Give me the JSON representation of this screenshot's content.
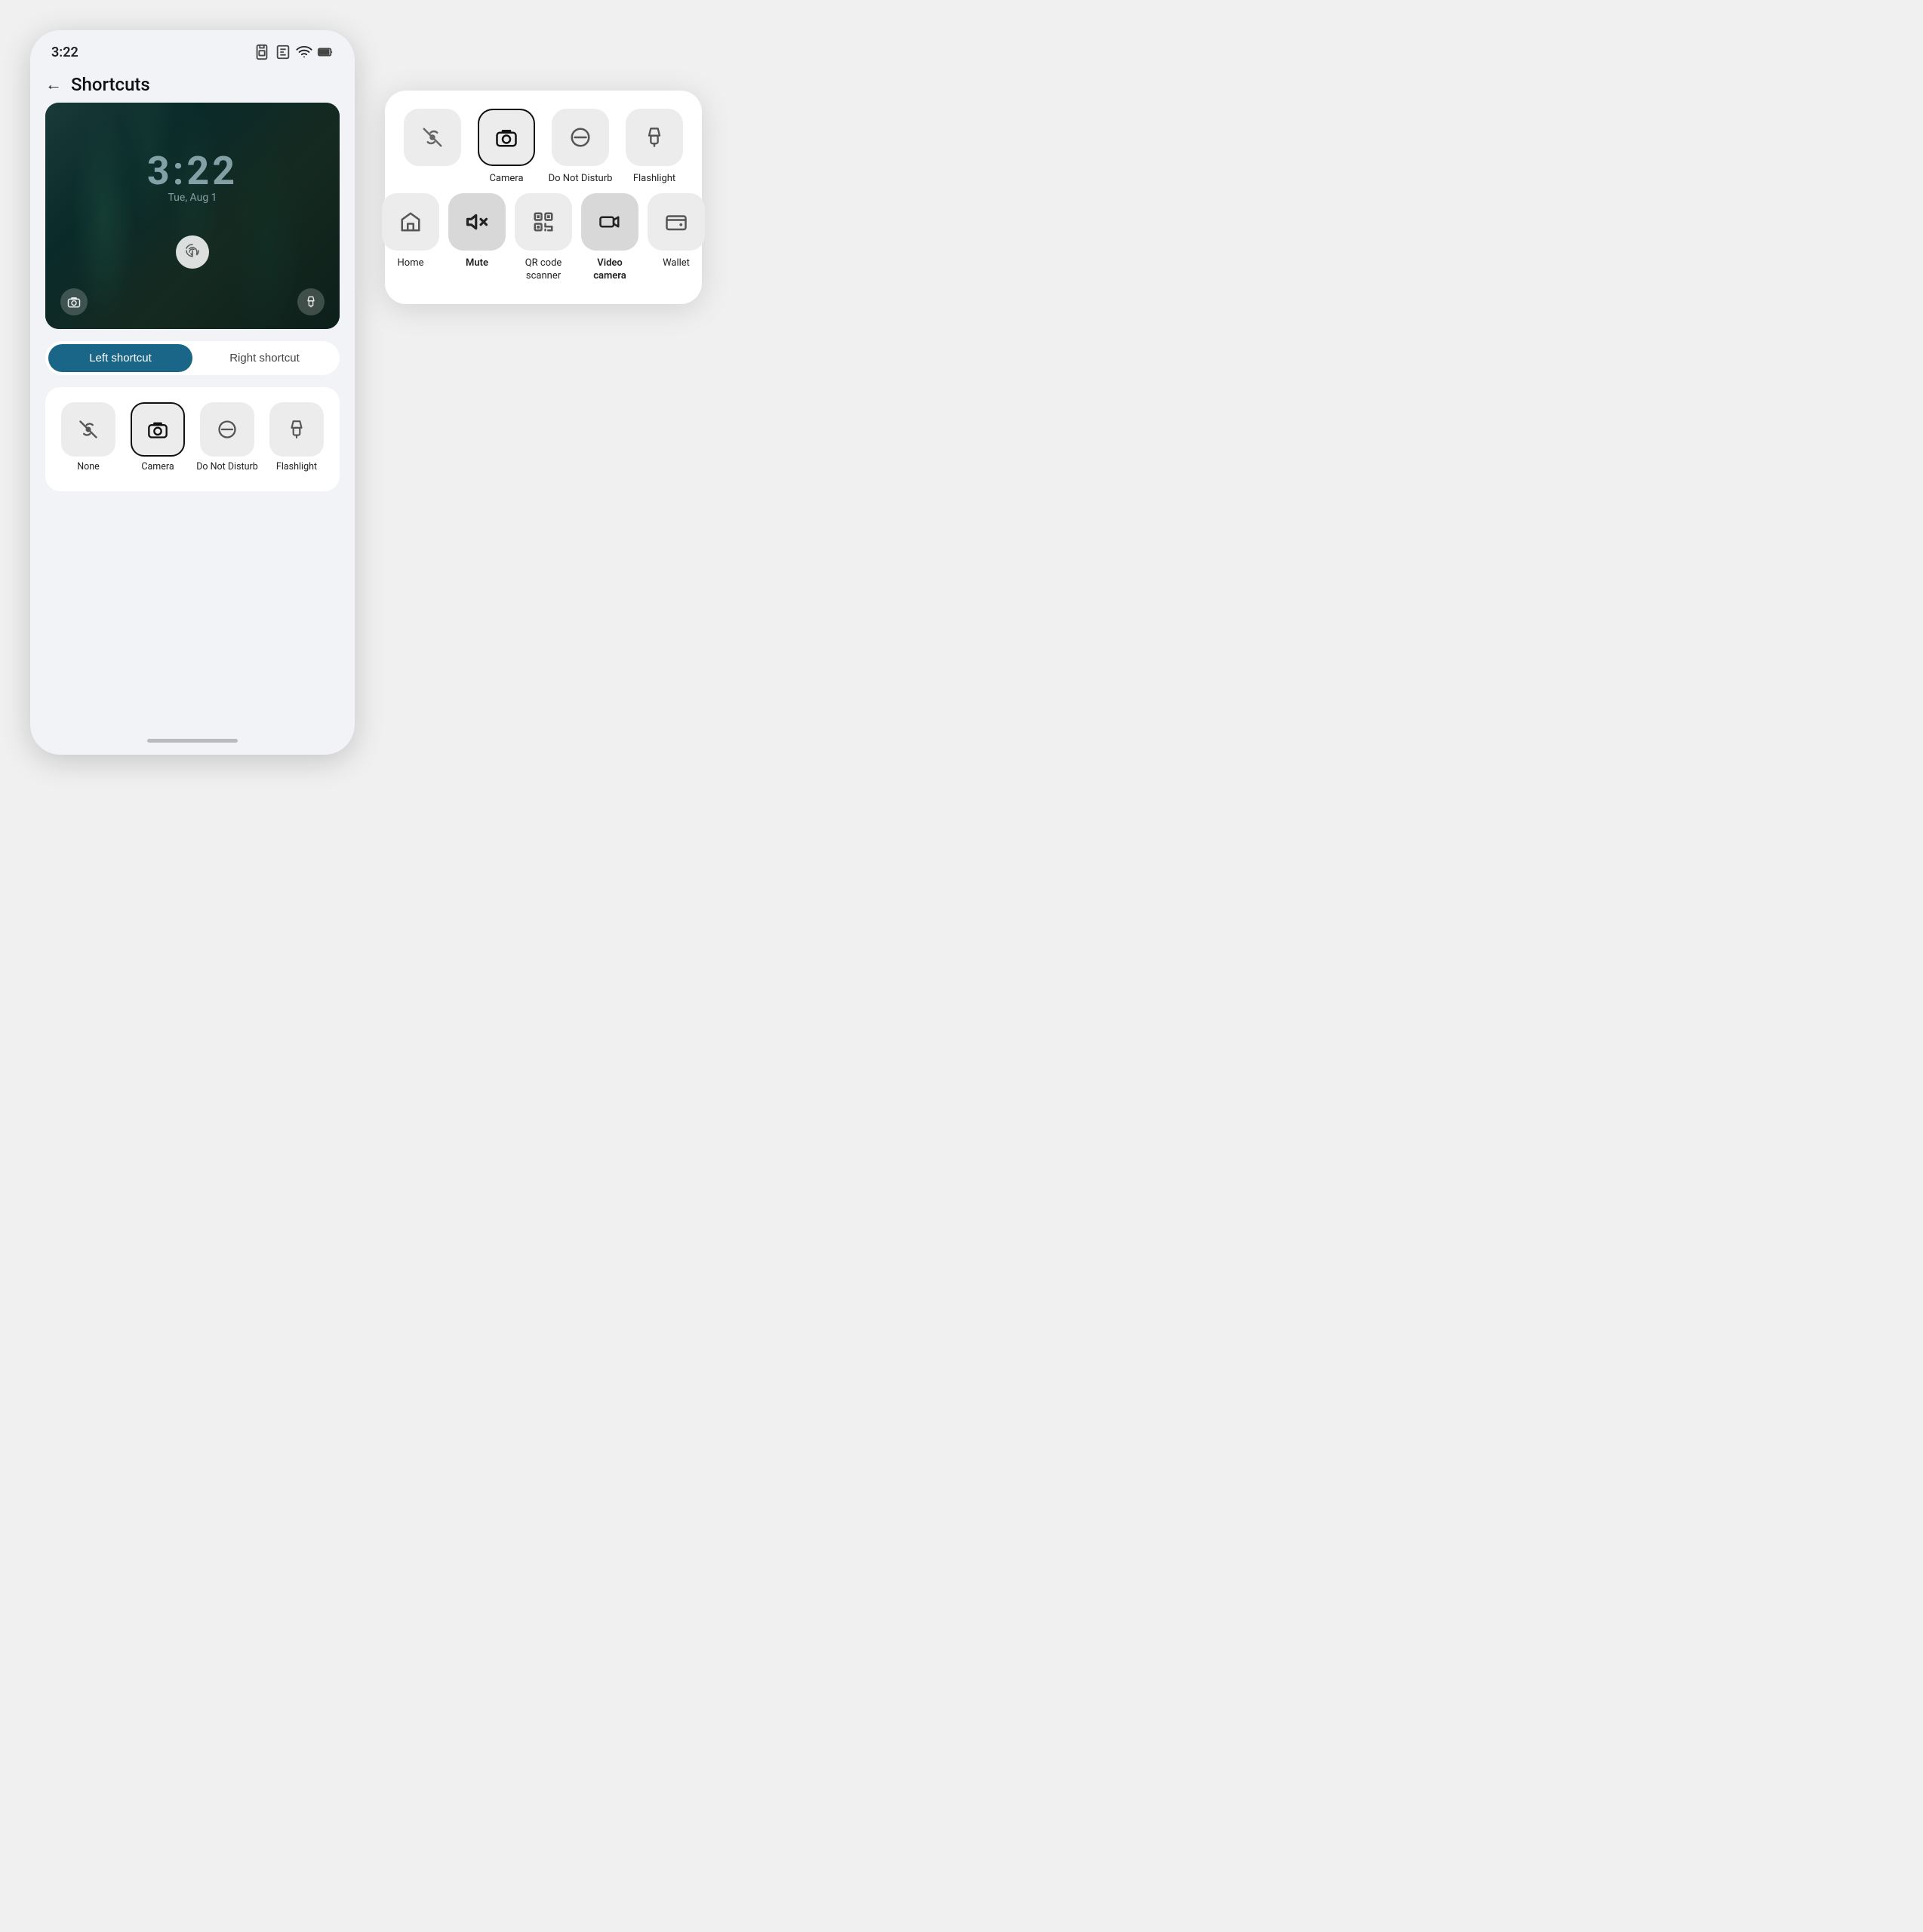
{
  "phone": {
    "status": {
      "time": "3:22",
      "icons": [
        "sim",
        "esim",
        "wifi",
        "battery"
      ]
    },
    "header": {
      "back_label": "←",
      "title": "Shortcuts"
    },
    "lockscreen": {
      "time": "3:22",
      "date": "Tue, Aug 1"
    },
    "tabs": {
      "left": "Left shortcut",
      "right": "Right shortcut",
      "active": "left"
    },
    "shortcut_options": [
      {
        "id": "none",
        "label": "None",
        "icon": "none",
        "selected": false
      },
      {
        "id": "camera",
        "label": "Camera",
        "icon": "camera",
        "selected": true
      },
      {
        "id": "dnd",
        "label": "Do Not\nDisturb",
        "icon": "dnd",
        "selected": false
      },
      {
        "id": "flashlight",
        "label": "Flashlight",
        "icon": "flashlight",
        "selected": false
      }
    ]
  },
  "popup": {
    "row1": [
      {
        "id": "none",
        "label": "",
        "icon": "none",
        "selected": false
      },
      {
        "id": "camera",
        "label": "Camera",
        "icon": "camera",
        "selected": true
      },
      {
        "id": "dnd",
        "label": "Do Not\nDisturb",
        "icon": "dnd",
        "selected": false
      },
      {
        "id": "flashlight",
        "label": "Flashlight",
        "icon": "flashlight",
        "selected": false
      }
    ],
    "row2": [
      {
        "id": "home",
        "label": "Home",
        "icon": "home",
        "selected": false
      },
      {
        "id": "mute",
        "label": "Mute",
        "icon": "mute",
        "selected": false
      },
      {
        "id": "qr",
        "label": "QR code\nscanner",
        "icon": "qr",
        "selected": false
      },
      {
        "id": "videocam",
        "label": "Video\ncamera",
        "icon": "videocam",
        "selected": false
      },
      {
        "id": "wallet",
        "label": "Wallet",
        "icon": "wallet",
        "selected": false
      }
    ]
  }
}
